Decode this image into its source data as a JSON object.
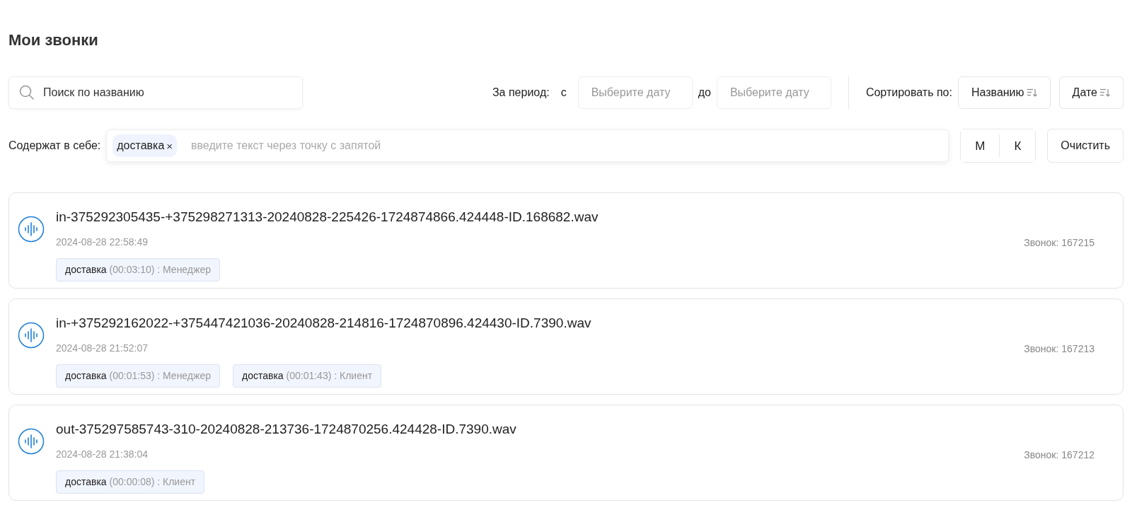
{
  "title": "Мои звонки",
  "search": {
    "placeholder": "Поиск по названию"
  },
  "period": {
    "label": "За период:",
    "from_label": "с",
    "from_placeholder": "Выберите дату",
    "to_label": "до",
    "to_placeholder": "Выберите дату"
  },
  "sort": {
    "label": "Сортировать по:",
    "buttons": [
      "Названию",
      "Дате"
    ]
  },
  "contains": {
    "label": "Содержат в себе:",
    "chips": [
      "доставка"
    ],
    "chip_remove": "×",
    "placeholder": "введите текст через точку с запятой"
  },
  "speaker_buttons": [
    "М",
    "К"
  ],
  "clear_button": "Очистить",
  "calls": [
    {
      "name": "in-375292305435-+375298271313-20240828-225426-1724874866.424448-ID.168682.wav",
      "date": "2024-08-28 22:58:49",
      "number": "Звонок: 167215",
      "tags": [
        {
          "keyword": "доставка",
          "detail": "(00:03:10) : Менеджер"
        }
      ]
    },
    {
      "name": "in-+375292162022-+375447421036-20240828-214816-1724870896.424430-ID.7390.wav",
      "date": "2024-08-28 21:52:07",
      "number": "Звонок: 167213",
      "tags": [
        {
          "keyword": "доставка",
          "detail": "(00:01:53) : Менеджер"
        },
        {
          "keyword": "доставка",
          "detail": "(00:01:43) : Клиент"
        }
      ]
    },
    {
      "name": "out-375297585743-310-20240828-213736-1724870256.424428-ID.7390.wav",
      "date": "2024-08-28 21:38:04",
      "number": "Звонок: 167212",
      "tags": [
        {
          "keyword": "доставка",
          "detail": "(00:00:08) : Клиент"
        }
      ]
    }
  ]
}
